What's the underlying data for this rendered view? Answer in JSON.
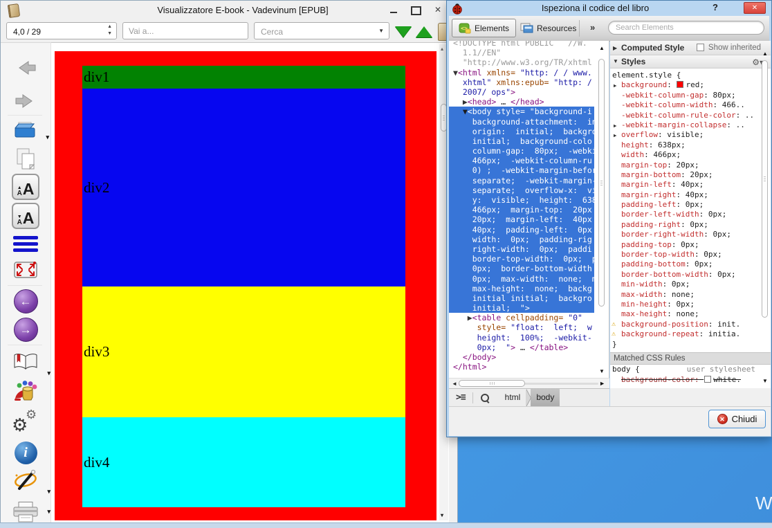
{
  "desktop": {
    "watermark": "W"
  },
  "ebook_window": {
    "title": "Visualizzatore E-book - Vadevinum [EPUB]",
    "toolbar": {
      "page_value": "4,0 / 29",
      "goto_placeholder": "Vai a...",
      "search_placeholder": "Cerca"
    },
    "sidebar_icons": [
      "back",
      "forward",
      "open-book-file",
      "duplicate-page",
      "increase-font",
      "decrease-font",
      "table-of-contents",
      "fit-screen",
      "previous-chapter",
      "next-chapter",
      "bookmarks",
      "appearance-colors",
      "settings-gears",
      "info",
      "magic-wand-tools",
      "print"
    ],
    "content": {
      "page_color": "#ff0000",
      "divs": [
        {
          "label": "div1",
          "color": "#028202"
        },
        {
          "label": "div2",
          "color": "#0606f0"
        },
        {
          "label": "div3",
          "color": "#ffff00"
        },
        {
          "label": "div4",
          "color": "#00ffff"
        }
      ]
    }
  },
  "inspector": {
    "title": "Ispeziona il codice del libro",
    "help_label": "?",
    "close_glyph": "✕",
    "tabs": [
      "Elements",
      "Resources"
    ],
    "overflow_chevron": "»",
    "search_placeholder": "Search Elements",
    "colors": {
      "selection": "#3875d7",
      "tag": "#881280",
      "attr_name": "#994500",
      "attr_value": "#1a1aa6",
      "property_name": "#c22e2e"
    },
    "code": {
      "lines": [
        {
          "first": true,
          "segs": [
            [
              "g",
              "<!DOCTYPE html PUBLIC   //W."
            ]
          ]
        },
        {
          "segs": [
            [
              "g",
              "  1.1//EN\""
            ]
          ]
        },
        {
          "segs": [
            [
              "g",
              "  \"http://www.w3.org/TR/xhtml"
            ]
          ]
        },
        {
          "segs": [
            [
              "w",
              "▼"
            ],
            [
              "t",
              "<html"
            ],
            [
              "a",
              " xmlns= "
            ],
            [
              "v",
              "\"http: / / www."
            ]
          ]
        },
        {
          "segs": [
            [
              "v",
              "  xhtml\""
            ],
            [
              "a",
              " xmlns:epub= "
            ],
            [
              "v",
              "\"http: /"
            ]
          ]
        },
        {
          "segs": [
            [
              "v",
              "  2007/ ops\""
            ],
            [
              "t",
              ">"
            ]
          ]
        },
        {
          "segs": [
            [
              "w",
              "  ▶"
            ],
            [
              "t",
              "<head>"
            ],
            [
              "p",
              " … "
            ],
            [
              "t",
              "</head>"
            ]
          ]
        },
        {
          "sel": true,
          "segs": [
            [
              "w",
              "  ▼"
            ],
            [
              "p",
              "<body style= \"background-i"
            ]
          ]
        },
        {
          "sel": true,
          "segs": [
            [
              "p",
              "    background-attachment:  in"
            ]
          ]
        },
        {
          "sel": true,
          "segs": [
            [
              "p",
              "    origin:  initial;  backgro"
            ]
          ]
        },
        {
          "sel": true,
          "segs": [
            [
              "p",
              "    initial;  background-colo"
            ]
          ]
        },
        {
          "sel": true,
          "segs": [
            [
              "p",
              "    column-gap:  80px;  -webki"
            ]
          ]
        },
        {
          "sel": true,
          "segs": [
            [
              "p",
              "    466px;  -webkit-column-ru"
            ]
          ]
        },
        {
          "sel": true,
          "segs": [
            [
              "p",
              "    0) ;  -webkit-margin-befor"
            ]
          ]
        },
        {
          "sel": true,
          "segs": [
            [
              "p",
              "    separate;  -webkit-margin-"
            ]
          ]
        },
        {
          "sel": true,
          "segs": [
            [
              "p",
              "    separate;  overflow-x:  vi"
            ]
          ]
        },
        {
          "sel": true,
          "segs": [
            [
              "p",
              "    y:  visible;  height:  638"
            ]
          ]
        },
        {
          "sel": true,
          "segs": [
            [
              "p",
              "    466px;  margin-top:  20px"
            ]
          ]
        },
        {
          "sel": true,
          "segs": [
            [
              "p",
              "    20px;  margin-left:  40px"
            ]
          ]
        },
        {
          "sel": true,
          "segs": [
            [
              "p",
              "    40px;  padding-left:  0px"
            ]
          ]
        },
        {
          "sel": true,
          "segs": [
            [
              "p",
              "    width:  0px;  padding-rig"
            ]
          ]
        },
        {
          "sel": true,
          "segs": [
            [
              "p",
              "    right-width:  0px;  paddi"
            ]
          ]
        },
        {
          "sel": true,
          "segs": [
            [
              "p",
              "    border-top-width:  0px;  p"
            ]
          ]
        },
        {
          "sel": true,
          "segs": [
            [
              "p",
              "    0px;  border-bottom-width"
            ]
          ]
        },
        {
          "sel": true,
          "segs": [
            [
              "p",
              "    0px;  max-width:  none;  m"
            ]
          ]
        },
        {
          "sel": true,
          "segs": [
            [
              "p",
              "    max-height:  none;  backg"
            ]
          ]
        },
        {
          "sel": true,
          "segs": [
            [
              "p",
              "    initial initial;  backgro"
            ]
          ]
        },
        {
          "sel": true,
          "segs": [
            [
              "p",
              "    initial;  \">"
            ]
          ]
        },
        {
          "segs": [
            [
              "w",
              "   ▶"
            ],
            [
              "t",
              "<table"
            ],
            [
              "a",
              " cellpadding= "
            ],
            [
              "v",
              "\"0\""
            ]
          ]
        },
        {
          "segs": [
            [
              "a",
              "     style= "
            ],
            [
              "v",
              "\"float:  left;  w"
            ]
          ]
        },
        {
          "segs": [
            [
              "v",
              "     height:  100%;  -webkit-"
            ]
          ]
        },
        {
          "segs": [
            [
              "v",
              "     0px;  \""
            ],
            [
              "t",
              ">"
            ],
            [
              "p",
              " … "
            ],
            [
              "t",
              "</table>"
            ]
          ]
        },
        {
          "segs": [
            [
              "t",
              "  </body>"
            ]
          ]
        },
        {
          "segs": [
            [
              "t",
              "</html>"
            ]
          ]
        }
      ]
    },
    "styles": {
      "computed_header": "Computed Style",
      "show_inherited": "Show inherited",
      "styles_header": "Styles",
      "gear_glyph": "⚙▾",
      "element_style_selector": "element.style {",
      "properties": [
        {
          "arrow": true,
          "name": "background",
          "swatch": "#ff0000",
          "value": "red;"
        },
        {
          "name": "-webkit-column-gap",
          "value": "80px;"
        },
        {
          "name": "-webkit-column-width",
          "value": "466.."
        },
        {
          "name": "-webkit-column-rule-color",
          "value": ".."
        },
        {
          "arrow": true,
          "name": "-webkit-margin-collapse",
          "value": ".."
        },
        {
          "arrow": true,
          "name": "overflow",
          "value": "visible;"
        },
        {
          "name": "height",
          "value": "638px;"
        },
        {
          "name": "width",
          "value": "466px;"
        },
        {
          "name": "margin-top",
          "value": "20px;"
        },
        {
          "name": "margin-bottom",
          "value": "20px;"
        },
        {
          "name": "margin-left",
          "value": "40px;"
        },
        {
          "name": "margin-right",
          "value": "40px;"
        },
        {
          "name": "padding-left",
          "value": "0px;"
        },
        {
          "name": "border-left-width",
          "value": "0px;"
        },
        {
          "name": "padding-right",
          "value": "0px;"
        },
        {
          "name": "border-right-width",
          "value": "0px;"
        },
        {
          "name": "padding-top",
          "value": "0px;"
        },
        {
          "name": "border-top-width",
          "value": "0px;"
        },
        {
          "name": "padding-bottom",
          "value": "0px;"
        },
        {
          "name": "border-bottom-width",
          "value": "0px;"
        },
        {
          "name": "min-width",
          "value": "0px;"
        },
        {
          "name": "max-width",
          "value": "none;"
        },
        {
          "name": "min-height",
          "value": "0px;"
        },
        {
          "name": "max-height",
          "value": "none;"
        },
        {
          "warn": true,
          "name": "background-position",
          "value": "init."
        },
        {
          "warn": true,
          "name": "background-repeat",
          "value": "initia."
        }
      ],
      "closing_brace": "}",
      "matched_header": "Matched CSS Rules",
      "matched_rule": {
        "selector": "body {",
        "origin": "user stylesheet",
        "properties": [
          {
            "name": "background-color:",
            "swatch": "#ffffff",
            "value": "white.",
            "struck": true
          }
        ]
      }
    },
    "breadcrumb": [
      "html",
      "body"
    ],
    "breadcrumb_selected": 1,
    "close_label": "Chiudi"
  }
}
